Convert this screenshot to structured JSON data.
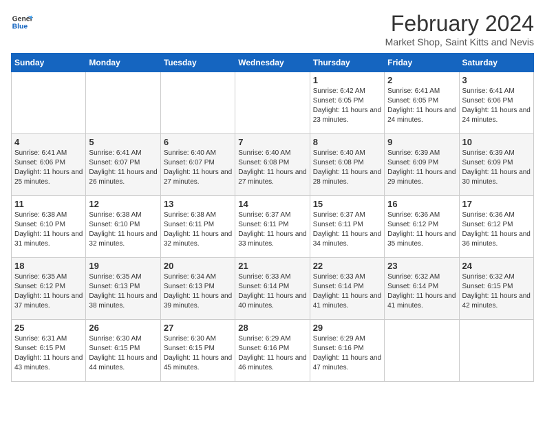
{
  "header": {
    "logo_line1": "General",
    "logo_line2": "Blue",
    "month_title": "February 2024",
    "subtitle": "Market Shop, Saint Kitts and Nevis"
  },
  "days_of_week": [
    "Sunday",
    "Monday",
    "Tuesday",
    "Wednesday",
    "Thursday",
    "Friday",
    "Saturday"
  ],
  "weeks": [
    [
      {
        "day": "",
        "info": ""
      },
      {
        "day": "",
        "info": ""
      },
      {
        "day": "",
        "info": ""
      },
      {
        "day": "",
        "info": ""
      },
      {
        "day": "1",
        "info": "Sunrise: 6:42 AM\nSunset: 6:05 PM\nDaylight: 11 hours and 23 minutes."
      },
      {
        "day": "2",
        "info": "Sunrise: 6:41 AM\nSunset: 6:05 PM\nDaylight: 11 hours and 24 minutes."
      },
      {
        "day": "3",
        "info": "Sunrise: 6:41 AM\nSunset: 6:06 PM\nDaylight: 11 hours and 24 minutes."
      }
    ],
    [
      {
        "day": "4",
        "info": "Sunrise: 6:41 AM\nSunset: 6:06 PM\nDaylight: 11 hours and 25 minutes."
      },
      {
        "day": "5",
        "info": "Sunrise: 6:41 AM\nSunset: 6:07 PM\nDaylight: 11 hours and 26 minutes."
      },
      {
        "day": "6",
        "info": "Sunrise: 6:40 AM\nSunset: 6:07 PM\nDaylight: 11 hours and 27 minutes."
      },
      {
        "day": "7",
        "info": "Sunrise: 6:40 AM\nSunset: 6:08 PM\nDaylight: 11 hours and 27 minutes."
      },
      {
        "day": "8",
        "info": "Sunrise: 6:40 AM\nSunset: 6:08 PM\nDaylight: 11 hours and 28 minutes."
      },
      {
        "day": "9",
        "info": "Sunrise: 6:39 AM\nSunset: 6:09 PM\nDaylight: 11 hours and 29 minutes."
      },
      {
        "day": "10",
        "info": "Sunrise: 6:39 AM\nSunset: 6:09 PM\nDaylight: 11 hours and 30 minutes."
      }
    ],
    [
      {
        "day": "11",
        "info": "Sunrise: 6:38 AM\nSunset: 6:10 PM\nDaylight: 11 hours and 31 minutes."
      },
      {
        "day": "12",
        "info": "Sunrise: 6:38 AM\nSunset: 6:10 PM\nDaylight: 11 hours and 32 minutes."
      },
      {
        "day": "13",
        "info": "Sunrise: 6:38 AM\nSunset: 6:11 PM\nDaylight: 11 hours and 32 minutes."
      },
      {
        "day": "14",
        "info": "Sunrise: 6:37 AM\nSunset: 6:11 PM\nDaylight: 11 hours and 33 minutes."
      },
      {
        "day": "15",
        "info": "Sunrise: 6:37 AM\nSunset: 6:11 PM\nDaylight: 11 hours and 34 minutes."
      },
      {
        "day": "16",
        "info": "Sunrise: 6:36 AM\nSunset: 6:12 PM\nDaylight: 11 hours and 35 minutes."
      },
      {
        "day": "17",
        "info": "Sunrise: 6:36 AM\nSunset: 6:12 PM\nDaylight: 11 hours and 36 minutes."
      }
    ],
    [
      {
        "day": "18",
        "info": "Sunrise: 6:35 AM\nSunset: 6:12 PM\nDaylight: 11 hours and 37 minutes."
      },
      {
        "day": "19",
        "info": "Sunrise: 6:35 AM\nSunset: 6:13 PM\nDaylight: 11 hours and 38 minutes."
      },
      {
        "day": "20",
        "info": "Sunrise: 6:34 AM\nSunset: 6:13 PM\nDaylight: 11 hours and 39 minutes."
      },
      {
        "day": "21",
        "info": "Sunrise: 6:33 AM\nSunset: 6:14 PM\nDaylight: 11 hours and 40 minutes."
      },
      {
        "day": "22",
        "info": "Sunrise: 6:33 AM\nSunset: 6:14 PM\nDaylight: 11 hours and 41 minutes."
      },
      {
        "day": "23",
        "info": "Sunrise: 6:32 AM\nSunset: 6:14 PM\nDaylight: 11 hours and 41 minutes."
      },
      {
        "day": "24",
        "info": "Sunrise: 6:32 AM\nSunset: 6:15 PM\nDaylight: 11 hours and 42 minutes."
      }
    ],
    [
      {
        "day": "25",
        "info": "Sunrise: 6:31 AM\nSunset: 6:15 PM\nDaylight: 11 hours and 43 minutes."
      },
      {
        "day": "26",
        "info": "Sunrise: 6:30 AM\nSunset: 6:15 PM\nDaylight: 11 hours and 44 minutes."
      },
      {
        "day": "27",
        "info": "Sunrise: 6:30 AM\nSunset: 6:15 PM\nDaylight: 11 hours and 45 minutes."
      },
      {
        "day": "28",
        "info": "Sunrise: 6:29 AM\nSunset: 6:16 PM\nDaylight: 11 hours and 46 minutes."
      },
      {
        "day": "29",
        "info": "Sunrise: 6:29 AM\nSunset: 6:16 PM\nDaylight: 11 hours and 47 minutes."
      },
      {
        "day": "",
        "info": ""
      },
      {
        "day": "",
        "info": ""
      }
    ]
  ]
}
